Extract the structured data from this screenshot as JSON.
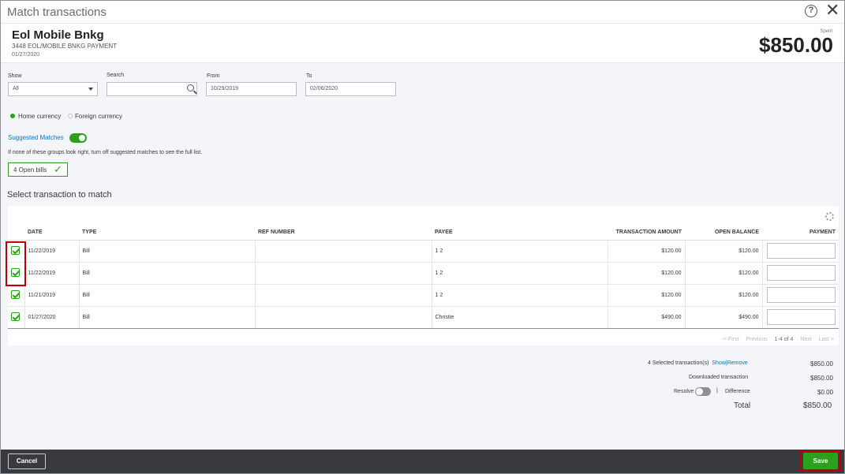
{
  "window": {
    "title": "Match transactions"
  },
  "transaction": {
    "payee": "Eol Mobile Bnkg",
    "description": "3448 EOL/MOBILE BNKG PAYMENT",
    "date": "01/27/2020",
    "spent_label": "Spent",
    "spent_amount": "$850.00"
  },
  "filters": {
    "show_label": "Show",
    "show_value": "All",
    "search_label": "Search",
    "search_value": "",
    "from_label": "From",
    "from_value": "10/29/2019",
    "to_label": "To",
    "to_value": "02/06/2020"
  },
  "currency": {
    "home_label": "Home currency",
    "foreign_label": "Foreign currency",
    "selected": "home"
  },
  "suggested": {
    "label": "Suggested Matches",
    "toggle_on": true,
    "hint": "If none of these groups look right, turn off suggested matches to see the full list.",
    "group_label": "4 Open bills"
  },
  "section_title": "Select transaction to match",
  "table": {
    "columns": [
      "DATE",
      "TYPE",
      "REF NUMBER",
      "PAYEE",
      "TRANSACTION AMOUNT",
      "OPEN BALANCE",
      "PAYMENT"
    ],
    "rows": [
      {
        "checked": true,
        "date": "11/22/2019",
        "type": "Bill",
        "ref": "",
        "payee": "1 2",
        "amount": "$120.00",
        "balance": "$120.00",
        "payment": ""
      },
      {
        "checked": true,
        "date": "11/22/2019",
        "type": "Bill",
        "ref": "",
        "payee": "1 2",
        "amount": "$120.00",
        "balance": "$120.00",
        "payment": ""
      },
      {
        "checked": true,
        "date": "11/21/2019",
        "type": "Bill",
        "ref": "",
        "payee": "1 2",
        "amount": "$120.00",
        "balance": "$120.00",
        "payment": ""
      },
      {
        "checked": true,
        "date": "01/27/2020",
        "type": "Bill",
        "ref": "",
        "payee": "Christie",
        "amount": "$490.00",
        "balance": "$490.00",
        "payment": ""
      }
    ]
  },
  "pager": {
    "first": "< First",
    "previous": "Previous",
    "range": "1-4 of 4",
    "next": "Next",
    "last": "Last >"
  },
  "summary": {
    "selected_label": "4 Selected transaction(s)",
    "show_link": "Show",
    "separator": "|",
    "remove_link": "Remove",
    "selected_value": "$850.00",
    "downloaded_label": "Downloaded transaction",
    "downloaded_value": "$850.00",
    "resolve_label": "Resolve",
    "difference_label": "Difference",
    "difference_value": "$0.00",
    "total_label": "Total",
    "total_value": "$850.00"
  },
  "footer": {
    "cancel_label": "Cancel",
    "save_label": "Save"
  },
  "colors": {
    "accent": "#2ca01c",
    "link": "#0077c5",
    "highlight": "#c00000"
  }
}
